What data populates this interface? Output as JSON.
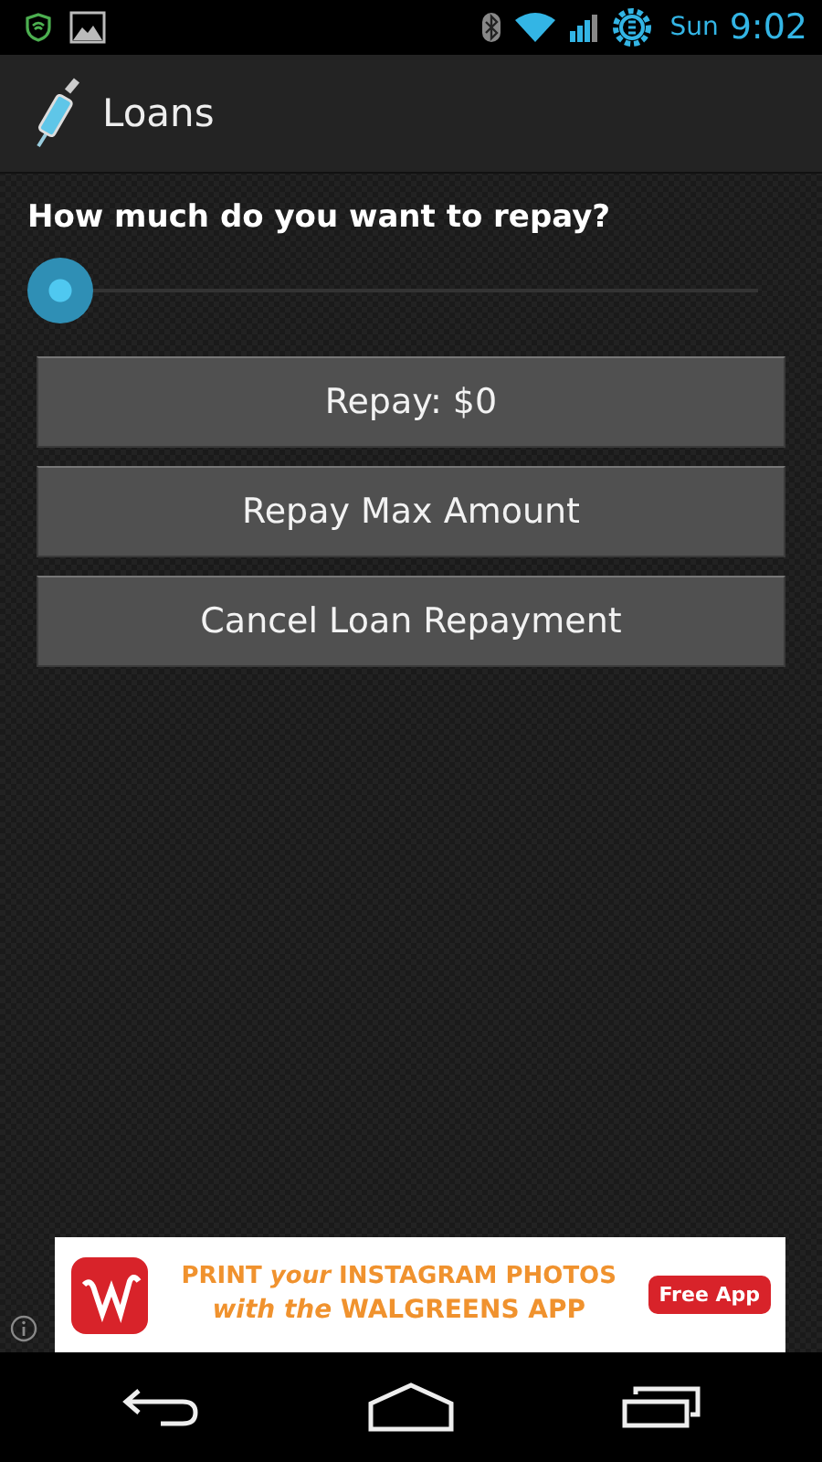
{
  "status_bar": {
    "day": "Sun",
    "time": "9:02"
  },
  "action_bar": {
    "title": "Loans"
  },
  "prompt": "How much do you want to repay?",
  "slider": {
    "level": 0
  },
  "buttons": [
    "Repay: $0",
    "Repay Max Amount",
    "Cancel Loan Repayment"
  ],
  "ad": {
    "line_1": "PRINT *your* INSTAGRAM PHOTOS",
    "line_2": "*with the* WALGREENS APP",
    "action": "Free App"
  }
}
